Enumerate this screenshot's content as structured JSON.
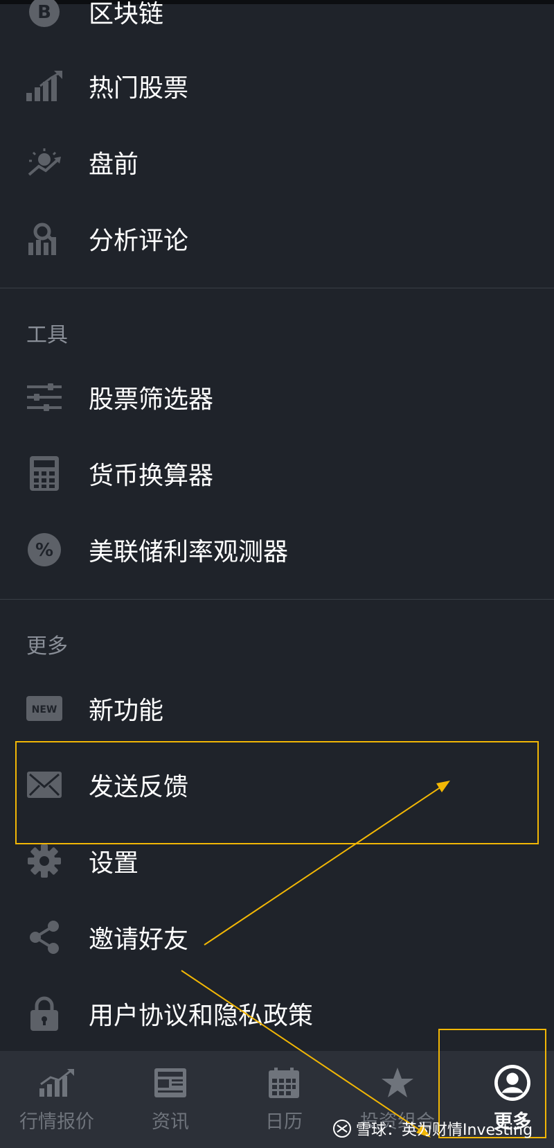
{
  "menu_top": [
    {
      "label": "区块链",
      "icon": "bitcoin-icon"
    },
    {
      "label": "热门股票",
      "icon": "bar-chart-icon"
    },
    {
      "label": "盘前",
      "icon": "sunrise-chart-icon"
    },
    {
      "label": "分析评论",
      "icon": "analyst-icon"
    }
  ],
  "tools": {
    "title": "工具",
    "items": [
      {
        "label": "股票筛选器",
        "icon": "sliders-icon"
      },
      {
        "label": "货币换算器",
        "icon": "calculator-icon"
      },
      {
        "label": "美联储利率观测器",
        "icon": "percent-icon"
      }
    ]
  },
  "more": {
    "title": "更多",
    "items": [
      {
        "label": "新功能",
        "icon": "new-badge-icon",
        "badge_text": "NEW"
      },
      {
        "label": "发送反馈",
        "icon": "envelope-icon"
      },
      {
        "label": "设置",
        "icon": "gear-icon"
      },
      {
        "label": "邀请好友",
        "icon": "share-icon"
      },
      {
        "label": "用户协议和隐私政策",
        "icon": "lock-icon"
      }
    ]
  },
  "bottom_nav": [
    {
      "label": "行情报价",
      "icon": "quotes-chart-icon",
      "active": false
    },
    {
      "label": "资讯",
      "icon": "news-icon",
      "active": false
    },
    {
      "label": "日历",
      "icon": "calendar-icon",
      "active": false
    },
    {
      "label": "投资组合",
      "icon": "star-icon",
      "active": false
    },
    {
      "label": "更多",
      "icon": "user-icon",
      "active": true
    }
  ],
  "watermark": {
    "text": "雪球：英为财情Investing"
  },
  "colors": {
    "background": "#1f232a",
    "bottom_bar": "#2c3038",
    "icon": "#5d6168",
    "highlight": "#f2b705",
    "section_title": "#8a8f98"
  }
}
